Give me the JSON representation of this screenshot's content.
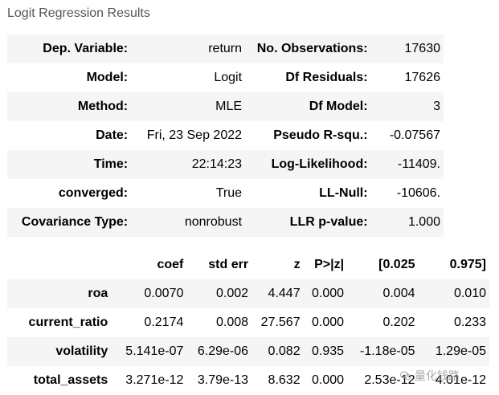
{
  "caption": "Logit Regression Results",
  "summary": {
    "rows": [
      [
        "Dep. Variable:",
        "return",
        "No. Observations:",
        "17630"
      ],
      [
        "Model:",
        "Logit",
        "Df Residuals:",
        "17626"
      ],
      [
        "Method:",
        "MLE",
        "Df Model:",
        "3"
      ],
      [
        "Date:",
        "Fri, 23 Sep 2022",
        "Pseudo R-squ.:",
        "-0.07567"
      ],
      [
        "Time:",
        "22:14:23",
        "Log-Likelihood:",
        "-11409."
      ],
      [
        "converged:",
        "True",
        "LL-Null:",
        "-10606."
      ],
      [
        "Covariance Type:",
        "nonrobust",
        "LLR p-value:",
        "1.000"
      ]
    ]
  },
  "coefficients": {
    "headers": [
      "",
      "coef",
      "std err",
      "z",
      "P>|z|",
      "[0.025",
      "0.975]"
    ],
    "rows": [
      [
        "roa",
        "0.0070",
        "0.002",
        "4.447",
        "0.000",
        "0.004",
        "0.010"
      ],
      [
        "current_ratio",
        "0.2174",
        "0.008",
        "27.567",
        "0.000",
        "0.202",
        "0.233"
      ],
      [
        "volatility",
        "5.141e-07",
        "6.29e-06",
        "0.082",
        "0.935",
        "-1.18e-05",
        "1.29e-05"
      ],
      [
        "total_assets",
        "3.271e-12",
        "3.79e-13",
        "8.632",
        "0.000",
        "2.53e-12",
        "4.01e-12"
      ]
    ]
  },
  "watermark": {
    "text": "量化钱路",
    "icon": "wechat-icon"
  }
}
